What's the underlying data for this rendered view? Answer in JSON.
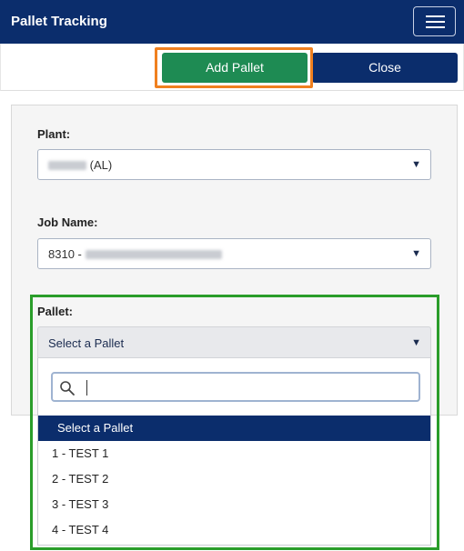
{
  "header": {
    "title": "Pallet Tracking",
    "menu_icon": "hamburger-icon"
  },
  "actions": {
    "add_pallet": "Add Pallet",
    "close": "Close",
    "colors": {
      "add": "#1e8b53",
      "close": "#0b2d6c",
      "highlight_add": "#f0801f"
    }
  },
  "form": {
    "plant": {
      "label": "Plant:",
      "value_suffix": "(AL)"
    },
    "job_name": {
      "label": "Job Name:",
      "value_prefix": "8310 -"
    },
    "pallet": {
      "label": "Pallet:",
      "selected": "Select a Pallet",
      "search": {
        "value": "",
        "icon": "search-icon"
      },
      "options": [
        {
          "label": "Select a Pallet",
          "selected": true
        },
        {
          "label": "1 - TEST 1",
          "selected": false
        },
        {
          "label": "2 - TEST 2",
          "selected": false
        },
        {
          "label": "3 - TEST 3",
          "selected": false
        },
        {
          "label": "4 - TEST 4",
          "selected": false
        }
      ],
      "highlight_color": "#2a9d2a"
    }
  }
}
